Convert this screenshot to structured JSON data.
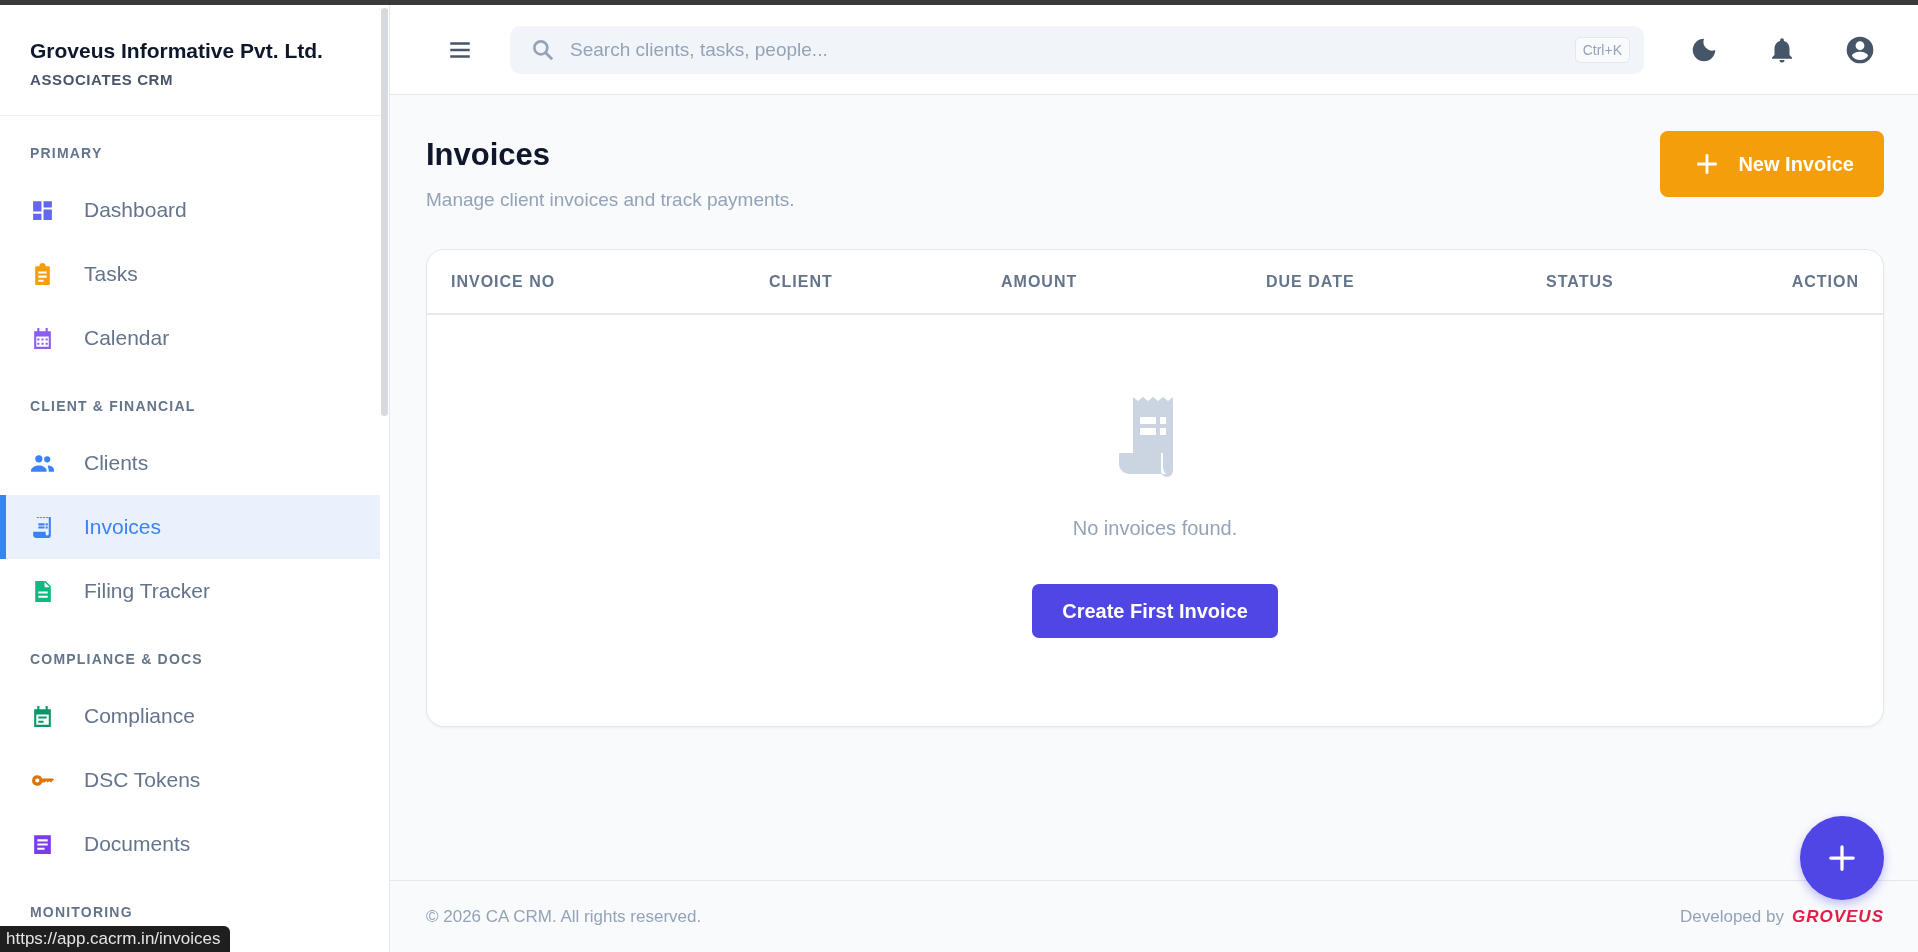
{
  "sidebar": {
    "company": "Groveus Informative Pvt. Ltd.",
    "subtitle": "ASSOCIATES CRM",
    "sections": [
      {
        "label": "PRIMARY",
        "items": [
          {
            "label": "Dashboard",
            "selected": false,
            "color": "#6366f1"
          },
          {
            "label": "Tasks",
            "selected": false,
            "color": "#f59e0b"
          },
          {
            "label": "Calendar",
            "selected": false,
            "color": "#8b5cf6"
          }
        ]
      },
      {
        "label": "CLIENT & FINANCIAL",
        "items": [
          {
            "label": "Clients",
            "selected": false,
            "color": "#3b82f6"
          },
          {
            "label": "Invoices",
            "selected": true,
            "color": "#3b82f6"
          },
          {
            "label": "Filing Tracker",
            "selected": false,
            "color": "#10b981"
          }
        ]
      },
      {
        "label": "COMPLIANCE & DOCS",
        "items": [
          {
            "label": "Compliance",
            "selected": false,
            "color": "#059669"
          },
          {
            "label": "DSC Tokens",
            "selected": false,
            "color": "#d97706"
          },
          {
            "label": "Documents",
            "selected": false,
            "color": "#7c3aed"
          }
        ]
      },
      {
        "label": "MONITORING"
      }
    ]
  },
  "header": {
    "search": {
      "placeholder": "Search clients, tasks, people..."
    },
    "shortcut": "Ctrl+K"
  },
  "page": {
    "title": "Invoices",
    "subtitle": "Manage client invoices and track payments.",
    "new_button": "New Invoice"
  },
  "table": {
    "columns": [
      "INVOICE NO",
      "CLIENT",
      "AMOUNT",
      "DUE DATE",
      "STATUS",
      "ACTION"
    ],
    "empty_text": "No invoices found.",
    "empty_button": "Create First Invoice"
  },
  "footer": {
    "copyright": "© 2026 CA CRM. All rights reserved.",
    "developed_by": "Developed by",
    "brand": "GROVEUS"
  },
  "status_url": "https://app.cacrm.in/invoices"
}
